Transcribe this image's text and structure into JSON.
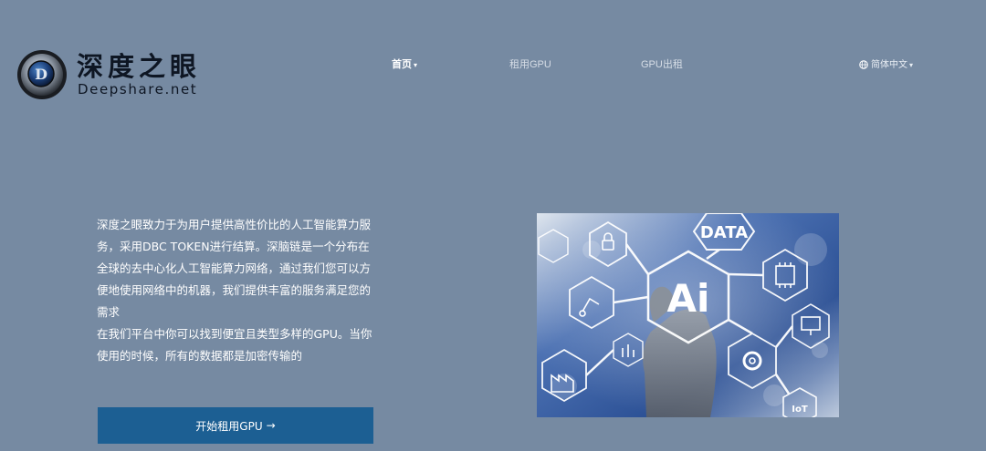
{
  "logo": {
    "title": "深度之眼",
    "subtitle": "Deepshare.net",
    "mark_letter": "D"
  },
  "nav": {
    "home": "首页",
    "rent_gpu": "租用GPU",
    "lend_gpu": "GPU出租",
    "language": "简体中文",
    "caret": "▾",
    "globe_icon": "globe-icon"
  },
  "intro": {
    "paragraph1": "深度之眼致力于为用户提供高性价比的人工智能算力服务，采用DBC TOKEN进行结算。深脑链是一个分布在全球的去中心化人工智能算力网络，通过我们您可以方便地使用网络中的机器，我们提供丰富的服务满足您的需求",
    "paragraph2": "在我们平台中你可以找到便宜且类型多样的GPU。当你使用的时候，所有的数据都是加密传输的"
  },
  "cta": {
    "label": "开始租用GPU",
    "arrow": "→"
  },
  "hero": {
    "center_text": "Ai",
    "data_text": "DATA",
    "iot_text": "IoT"
  },
  "colors": {
    "background": "#768aa2",
    "button": "#1c5f93",
    "logo_text": "#0e1623"
  }
}
